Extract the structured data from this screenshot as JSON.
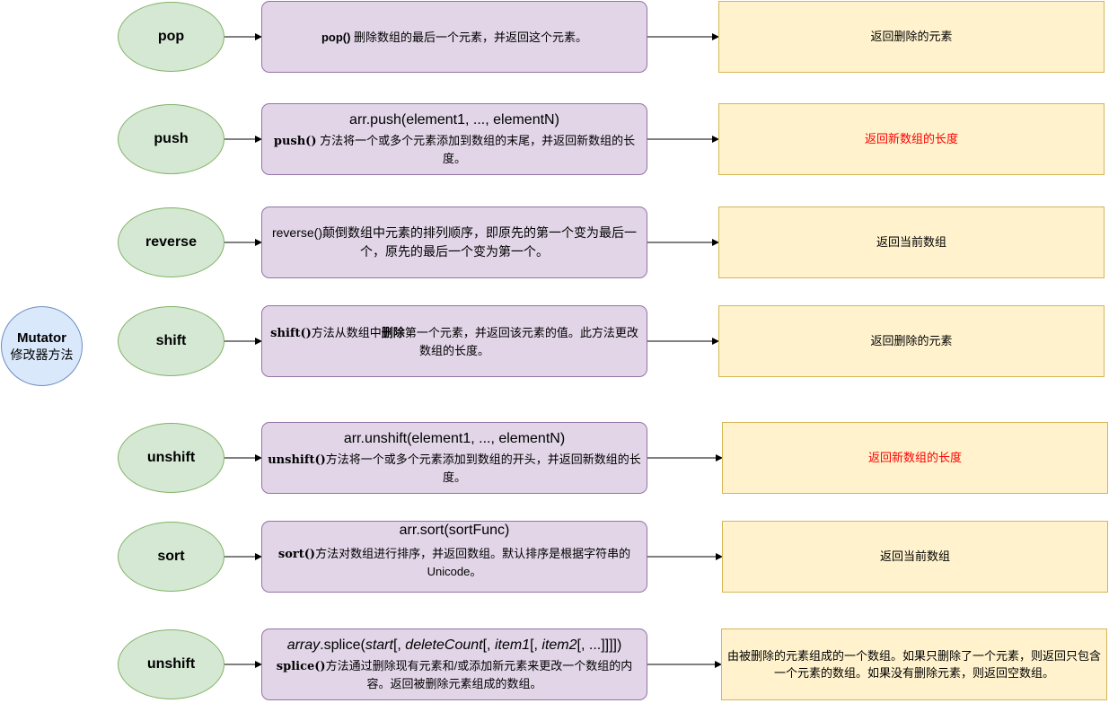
{
  "root": {
    "title": "Mutator",
    "subtitle": "修改器方法"
  },
  "rows": [
    {
      "method": "pop",
      "desc_bold": "pop()",
      "desc_rest": " 删除数组的最后一个元素，并返回这个元素。",
      "ret": "返回删除的元素"
    },
    {
      "method": "push",
      "signature": "arr.push(element1, ..., elementN)",
      "desc_code": "push()",
      "desc_rest": " 方法将一个或多个元素添加到数组的末尾，并返回新数组的长度。",
      "ret": "返回新数组的长度",
      "ret_color": "#ff0000"
    },
    {
      "method": "reverse",
      "desc_text": "reverse()颠倒数组中元素的排列顺序，即原先的第一个变为最后一个，原先的最后一个变为第一个。",
      "ret": "返回当前数组"
    },
    {
      "method": "shift",
      "desc_code": "shift()",
      "desc_pre": "方法从数组中",
      "desc_bold": "删除",
      "desc_rest": "第一个元素，并返回该元素的值。此方法更改数组的长度。",
      "ret": "返回删除的元素"
    },
    {
      "method": "unshift",
      "signature": "arr.unshift(element1, ..., elementN)",
      "desc_code": "unshift()",
      "desc_rest": "方法将一个或多个元素添加到数组的开头，并返回新数组的长度。",
      "ret": "返回新数组的长度",
      "ret_color": "#ff0000"
    },
    {
      "method": "sort",
      "signature": "arr.sort(sortFunc)",
      "desc_code": "sort()",
      "desc_rest": "方法对数组进行排序，并返回数组。默认排序是根据字符串的Unicode。",
      "ret": "返回当前数组"
    },
    {
      "method": "unshift",
      "sig_parts": [
        "array",
        ".splice(",
        "start",
        "[, ",
        "deleteCount",
        "[, ",
        "item1",
        "[, ",
        "item2",
        "[, ...]]]])"
      ],
      "desc_code": "splice()",
      "desc_rest": "方法通过删除现有元素和/或添加新元素来更改一个数组的内容。返回被删除元素组成的数组。",
      "ret": "由被删除的元素组成的一个数组。如果只删除了一个元素，则返回只包含一个元素的数组。如果没有删除元素，则返回空数组。"
    }
  ]
}
